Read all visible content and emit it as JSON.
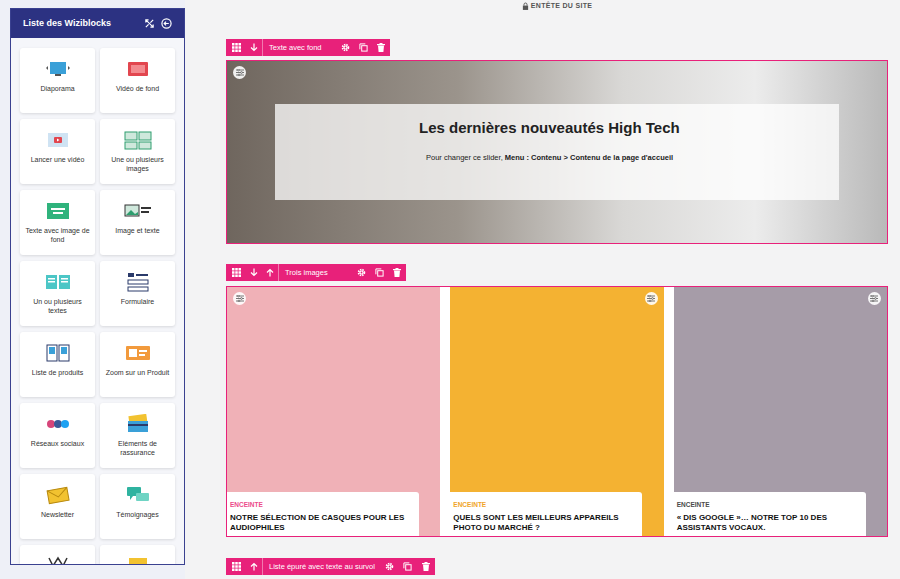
{
  "sidebar": {
    "title": "Liste des Wiziblocks",
    "items": [
      {
        "label": "Diaporama"
      },
      {
        "label": "Vidéo de fond"
      },
      {
        "label": "Lancer une vidéo"
      },
      {
        "label": "Une ou plusieurs images"
      },
      {
        "label": "Texte avec image de fond"
      },
      {
        "label": "Image et texte"
      },
      {
        "label": "Un ou plusieurs textes"
      },
      {
        "label": "Formulaire"
      },
      {
        "label": "Liste de produits"
      },
      {
        "label": "Zoom sur un Produit"
      },
      {
        "label": "Réseaux sociaux"
      },
      {
        "label": "Eléments de rassurance"
      },
      {
        "label": "Newsletter"
      },
      {
        "label": "Témoignages"
      }
    ]
  },
  "header_label": "ENTÊTE DU SITE",
  "blocks": [
    {
      "kind": "hero",
      "label": "Texte avec fond",
      "move_up": false,
      "move_down": true,
      "title": "Les dernières nouveautés High Tech",
      "text": [
        {
          "text": "Pour changer ce slider, ",
          "bold": false
        },
        {
          "text": "Menu : Contenu > Contenu de la page d'accueil",
          "bold": true
        }
      ]
    },
    {
      "kind": "images",
      "label": "Trois images",
      "move_up": true,
      "move_down": true,
      "items": [
        {
          "tag": "ENCEINTE",
          "color": "#ec4a8a",
          "title": "NOTRE SÉLECTION DE CASQUES POUR LES AUDIOPHILES",
          "settings_icon": false
        },
        {
          "tag": "ENCEINTE",
          "color": "#f0a428",
          "title": "QUELS SONT LES MEILLEURS APPAREILS PHOTO DU MARCHÉ ?",
          "settings_icon": true
        },
        {
          "tag": "ENCEINTE",
          "color": "#4a4a4a",
          "title": "« DIS GOOGLE »… NOTRE TOP 10 DES ASSISTANTS VOCAUX.",
          "settings_icon": true
        }
      ]
    },
    {
      "kind": "list",
      "label": "Liste épuré avec texte au survol",
      "move_up": true,
      "move_down": false
    }
  ]
}
